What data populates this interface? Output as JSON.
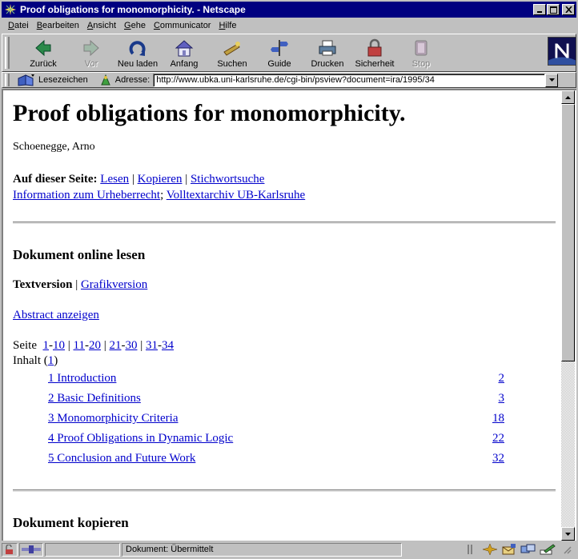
{
  "window": {
    "title": "Proof obligations for monomorphicity. - Netscape"
  },
  "menu": [
    {
      "label": "Datei",
      "key": "D",
      "rest": "atei"
    },
    {
      "label": "Bearbeiten",
      "key": "B",
      "rest": "earbeiten"
    },
    {
      "label": "Ansicht",
      "key": "A",
      "rest": "nsicht"
    },
    {
      "label": "Gehe",
      "key": "G",
      "rest": "ehe"
    },
    {
      "label": "Communicator",
      "key": "C",
      "rest": "ommunicator"
    },
    {
      "label": "Hilfe",
      "key": "H",
      "rest": "ilfe"
    }
  ],
  "toolbar": {
    "back": "Zurück",
    "forward": "Vor",
    "reload": "Neu laden",
    "home": "Anfang",
    "search": "Suchen",
    "guide": "Guide",
    "print": "Drucken",
    "security": "Sicherheit",
    "stop": "Stop"
  },
  "locationbar": {
    "bookmarks": "Lesezeichen",
    "address_label": "Adresse:",
    "url": "http://www.ubka.uni-karlsruhe.de/cgi-bin/psview?document=ira/1995/34"
  },
  "page": {
    "title": "Proof obligations for monomorphicity.",
    "author": "Schoenegge, Arno",
    "on_page_label": "Auf dieser Seite:",
    "links": {
      "read": "Lesen",
      "copy": "Kopieren",
      "keyword_search": "Stichwortsuche",
      "copyright": "Information zum Urheberrecht",
      "archive": "Volltextarchiv UB-Karlsruhe"
    },
    "read_section": {
      "heading": "Dokument online lesen",
      "text_version": "Textversion",
      "graphic_version": "Grafikversion",
      "show_abstract": "Abstract anzeigen",
      "page_label": "Seite",
      "page_ranges": [
        {
          "from": "1",
          "to": "10"
        },
        {
          "from": "11",
          "to": "20"
        },
        {
          "from": "21",
          "to": "30"
        },
        {
          "from": "31",
          "to": "34"
        }
      ],
      "contents_label": "Inhalt",
      "contents_page": "1",
      "toc": [
        {
          "title": "1 Introduction",
          "page": "2"
        },
        {
          "title": "2 Basic Definitions",
          "page": "3"
        },
        {
          "title": "3 Monomorphicity Criteria",
          "page": "18"
        },
        {
          "title": "4 Proof Obligations in Dynamic Logic",
          "page": "22"
        },
        {
          "title": "5 Conclusion and Future Work",
          "page": "32"
        }
      ]
    },
    "copy_section": {
      "heading": "Dokument kopieren"
    }
  },
  "status": {
    "text": "Dokument: Übermittelt"
  }
}
